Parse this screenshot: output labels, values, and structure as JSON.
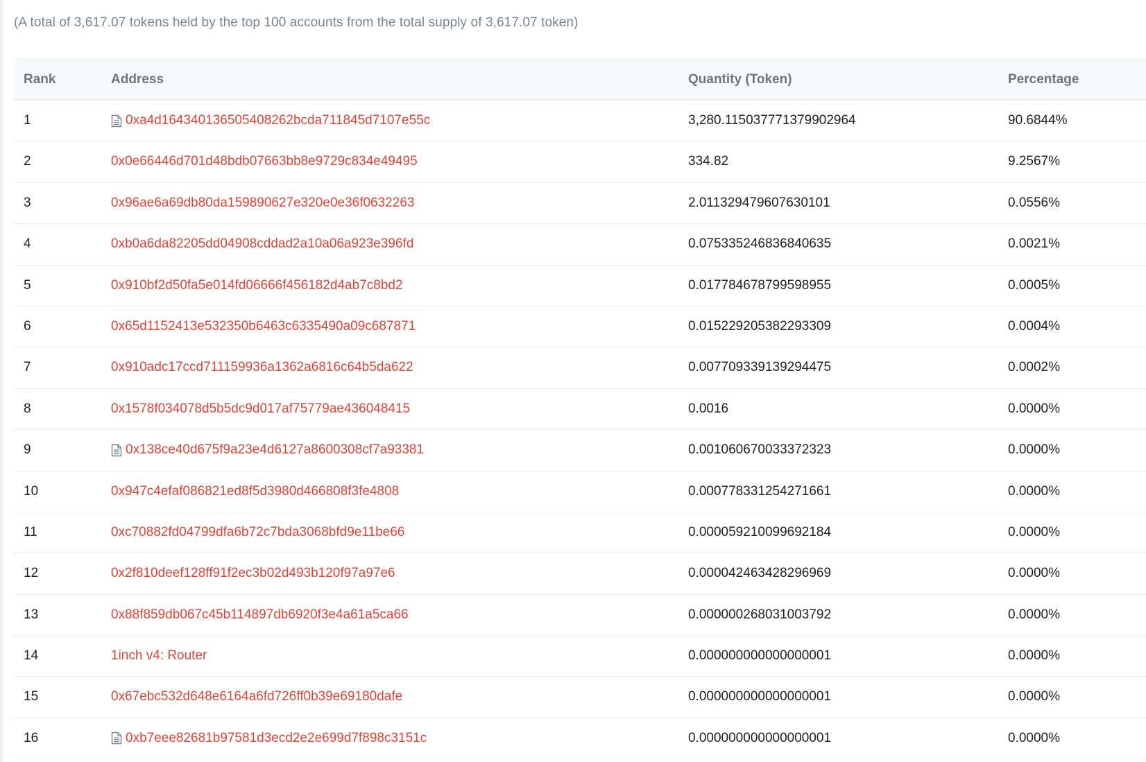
{
  "summary": "(A total of 3,617.07 tokens held by the top 100 accounts from the total supply of 3,617.07 token)",
  "table": {
    "headers": {
      "rank": "Rank",
      "address": "Address",
      "quantity": "Quantity (Token)",
      "percentage": "Percentage"
    },
    "rows": [
      {
        "rank": "1",
        "address": "0xa4d164340136505408262bcda711845d7107e55c",
        "contract": true,
        "quantity": "3,280.115037771379902964",
        "percentage": "90.6844%"
      },
      {
        "rank": "2",
        "address": "0x0e66446d701d48bdb07663bb8e9729c834e49495",
        "contract": false,
        "quantity": "334.82",
        "percentage": "9.2567%"
      },
      {
        "rank": "3",
        "address": "0x96ae6a69db80da159890627e320e0e36f0632263",
        "contract": false,
        "quantity": "2.011329479607630101",
        "percentage": "0.0556%"
      },
      {
        "rank": "4",
        "address": "0xb0a6da82205dd04908cddad2a10a06a923e396fd",
        "contract": false,
        "quantity": "0.075335246836840635",
        "percentage": "0.0021%"
      },
      {
        "rank": "5",
        "address": "0x910bf2d50fa5e014fd06666f456182d4ab7c8bd2",
        "contract": false,
        "quantity": "0.017784678799598955",
        "percentage": "0.0005%"
      },
      {
        "rank": "6",
        "address": "0x65d1152413e532350b6463c6335490a09c687871",
        "contract": false,
        "quantity": "0.015229205382293309",
        "percentage": "0.0004%"
      },
      {
        "rank": "7",
        "address": "0x910adc17ccd711159936a1362a6816c64b5da622",
        "contract": false,
        "quantity": "0.007709339139294475",
        "percentage": "0.0002%"
      },
      {
        "rank": "8",
        "address": "0x1578f034078d5b5dc9d017af75779ae436048415",
        "contract": false,
        "quantity": "0.0016",
        "percentage": "0.0000%"
      },
      {
        "rank": "9",
        "address": "0x138ce40d675f9a23e4d6127a8600308cf7a93381",
        "contract": true,
        "quantity": "0.001060670033372323",
        "percentage": "0.0000%"
      },
      {
        "rank": "10",
        "address": "0x947c4efaf086821ed8f5d3980d466808f3fe4808",
        "contract": false,
        "quantity": "0.000778331254271661",
        "percentage": "0.0000%"
      },
      {
        "rank": "11",
        "address": "0xc70882fd04799dfa6b72c7bda3068bfd9e11be66",
        "contract": false,
        "quantity": "0.000059210099692184",
        "percentage": "0.0000%"
      },
      {
        "rank": "12",
        "address": "0x2f810deef128ff91f2ec3b02d493b120f97a97e6",
        "contract": false,
        "quantity": "0.000042463428296969",
        "percentage": "0.0000%"
      },
      {
        "rank": "13",
        "address": "0x88f859db067c45b114897db6920f3e4a61a5ca66",
        "contract": false,
        "quantity": "0.000000268031003792",
        "percentage": "0.0000%"
      },
      {
        "rank": "14",
        "address": "1inch v4: Router",
        "contract": false,
        "quantity": "0.000000000000000001",
        "percentage": "0.0000%"
      },
      {
        "rank": "15",
        "address": "0x67ebc532d648e6164a6fd726ff0b39e69180dafe",
        "contract": false,
        "quantity": "0.000000000000000001",
        "percentage": "0.0000%"
      },
      {
        "rank": "16",
        "address": "0xb7eee82681b97581d3ecd2e2e699d7f898c3151c",
        "contract": true,
        "quantity": "0.000000000000000001",
        "percentage": "0.0000%"
      }
    ]
  },
  "colors": {
    "link": "#de4437",
    "muted_text": "#77838f",
    "header_bg": "#f8f9fa",
    "border": "#e7eaf3"
  },
  "icons": {
    "contract": "document-icon"
  }
}
